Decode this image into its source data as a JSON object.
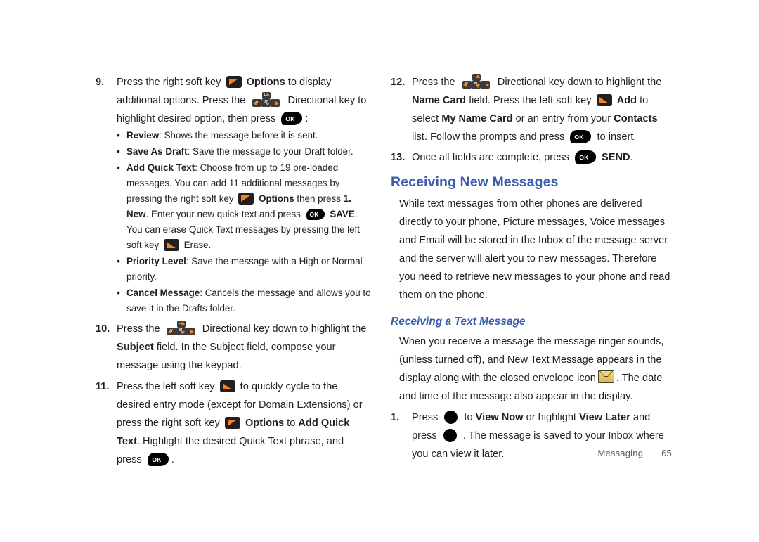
{
  "document": {
    "footer": {
      "section": "Messaging",
      "page_number": "65"
    }
  },
  "left_column": {
    "step9": {
      "number": "9.",
      "text_1": "Press the right soft key",
      "bold_1": "Options",
      "text_2": "to display additional options. Press the",
      "text_3": "Directional key to highlight desired option, then press",
      "text_4": ":",
      "bullets": [
        {
          "bold": "Review",
          "text": ": Shows the message before it is sent."
        },
        {
          "bold": "Save As Draft",
          "text": ": Save the message to your Draft folder."
        }
      ],
      "bullet_add_quick_text": {
        "bold": "Add Quick Text",
        "t1": ": Choose from up to 19 pre-loaded messages. You can add 11 additional messages by pressing the right soft key",
        "b2": "Options",
        "t2": "then press",
        "b3": "1. New",
        "t3": ". Enter your new quick text and press",
        "b4": "SAVE",
        "t4": ". You can erase Quick Text messages by pressing the left soft key",
        "t5": "Erase."
      },
      "bullets_tail": [
        {
          "bold": "Priority Level",
          "text": ": Save the message with a High or Normal priority."
        },
        {
          "bold": "Cancel Message",
          "text": ": Cancels the message and allows you to save it in the Drafts folder."
        }
      ]
    },
    "step10": {
      "number": "10.",
      "text_1": "Press the",
      "text_2": "Directional key down to highlight the",
      "bold_1": "Subject",
      "text_3": "field. In the Subject field, compose your message using the keypad."
    },
    "step11": {
      "number": "11.",
      "text_1": "Press the left soft key",
      "text_2": "to quickly cycle to the desired entry mode (except for Domain Extensions) or press the right soft key",
      "bold_1": "Options",
      "text_3": "to",
      "bold_2": "Add Quick Text",
      "text_4": ". Highlight the desired Quick Text phrase, and press",
      "text_5": "."
    }
  },
  "right_column": {
    "step12": {
      "number": "12.",
      "text_1": "Press the",
      "text_2": "Directional key down to highlight the",
      "bold_1": "Name Card",
      "text_3": "field. Press the left soft key",
      "bold_2": "Add",
      "text_4": "to select",
      "bold_3": "My Name Card",
      "text_5": "or an entry from your",
      "bold_4": "Contacts",
      "text_6": "list. Follow the prompts and press",
      "text_7": "to insert."
    },
    "step13": {
      "number": "13.",
      "text_1": "Once all fields are complete, press",
      "bold_1": "SEND",
      "text_2": "."
    },
    "heading_new_messages": "Receiving New Messages",
    "paragraph_new_messages": "While text messages from other phones are delivered directly to your phone, Picture messages, Voice messages and Email will be stored in the Inbox of the message server and the server will alert you to new messages. Therefore you need to retrieve new messages to your phone and read them on the phone.",
    "heading_text_message": "Receiving a Text Message",
    "paragraph_text_message_1": "When you receive a message the message ringer sounds, (unless turned off), and New Text Message appears in the display along with the closed envelope icon",
    "paragraph_text_message_2": ". The date and time of the message also appear in the display.",
    "step1": {
      "number": "1.",
      "text_1": "Press",
      "text_2": "to",
      "bold_1": "View Now",
      "text_3": "or highlight",
      "bold_2": "View Later",
      "text_4": "and press",
      "text_5": ". The message is saved to your Inbox where you can view it later."
    }
  },
  "icons": {
    "soft_key_right": "right-soft-key-icon",
    "soft_key_left": "left-soft-key-icon",
    "ok_key_label": "OK",
    "directional_key": "directional-key-icon",
    "directional_key_labels": {
      "up": "L",
      "left": "N",
      "mid": "M",
      "right": ""
    },
    "envelope": "closed-envelope-icon",
    "center_select": "center-select-key-icon"
  },
  "colors": {
    "heading_blue": "#3a5dac",
    "accent_orange": "#f58220",
    "key_dark": "#231f20",
    "envelope_gold": "#e3c75c",
    "body_text": "#231f20",
    "footer_gray": "#58595b"
  }
}
